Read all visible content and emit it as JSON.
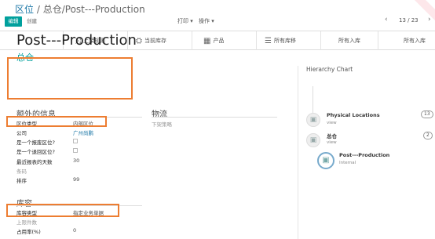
{
  "breadcrumb": {
    "parent": "区位",
    "separator": "/",
    "current": "总仓/Post---Production"
  },
  "toolbar": {
    "edit_label": "编辑",
    "create_label": "创建",
    "print_label": "打印 ▾",
    "action_label": "操作 ▾"
  },
  "pager": {
    "value": "13 / 23"
  },
  "smart_buttons": [
    {
      "label": "上架规则",
      "icon": "shuffle-icon",
      "glyph": "⤨"
    },
    {
      "label": "当前库存",
      "icon": "cubes-icon",
      "glyph": "⛭"
    },
    {
      "label": "产品",
      "icon": "products-icon",
      "glyph": "▦"
    },
    {
      "label": "所有库移",
      "icon": "list-icon",
      "glyph": "☰"
    },
    {
      "label": "所有入库",
      "icon": "",
      "glyph": ""
    },
    {
      "label": "所有入库",
      "icon": "",
      "glyph": ""
    }
  ],
  "record": {
    "name": "Post---Production",
    "parent": "总仓"
  },
  "extra_info": {
    "heading": "额外的信息",
    "fields": [
      {
        "label": "区位类型",
        "value": "内部区位"
      },
      {
        "label": "公司",
        "value": "广州尚鹏"
      },
      {
        "label": "是一个报废区位?",
        "value": ""
      },
      {
        "label": "是一个退回区位?",
        "value": ""
      },
      {
        "label": "最近报表的天数",
        "value": "30"
      },
      {
        "label": "条码",
        "value": ""
      },
      {
        "label": "排序",
        "value": "99"
      }
    ]
  },
  "logistics": {
    "heading": "物流",
    "fields": [
      {
        "label": "下架策略",
        "value": ""
      }
    ]
  },
  "capacity": {
    "heading": "库容",
    "fields": [
      {
        "label": "库容类型",
        "value": "指定业务单据"
      },
      {
        "label": "上限件数",
        "value": ""
      },
      {
        "label": "占用率(%)",
        "value": "0"
      }
    ]
  },
  "hierarchy": {
    "title": "Hierarchy Chart",
    "nodes": [
      {
        "name": "Physical Locations",
        "sub": "view",
        "count": "13"
      },
      {
        "name": "总仓",
        "sub": "view",
        "count": "2"
      },
      {
        "name": "Post---Production",
        "sub": "Internal",
        "count": ""
      }
    ]
  },
  "colors": {
    "accent": "#00a09d",
    "link": "#1f79a8",
    "highlight_border": "#ed7d31"
  }
}
